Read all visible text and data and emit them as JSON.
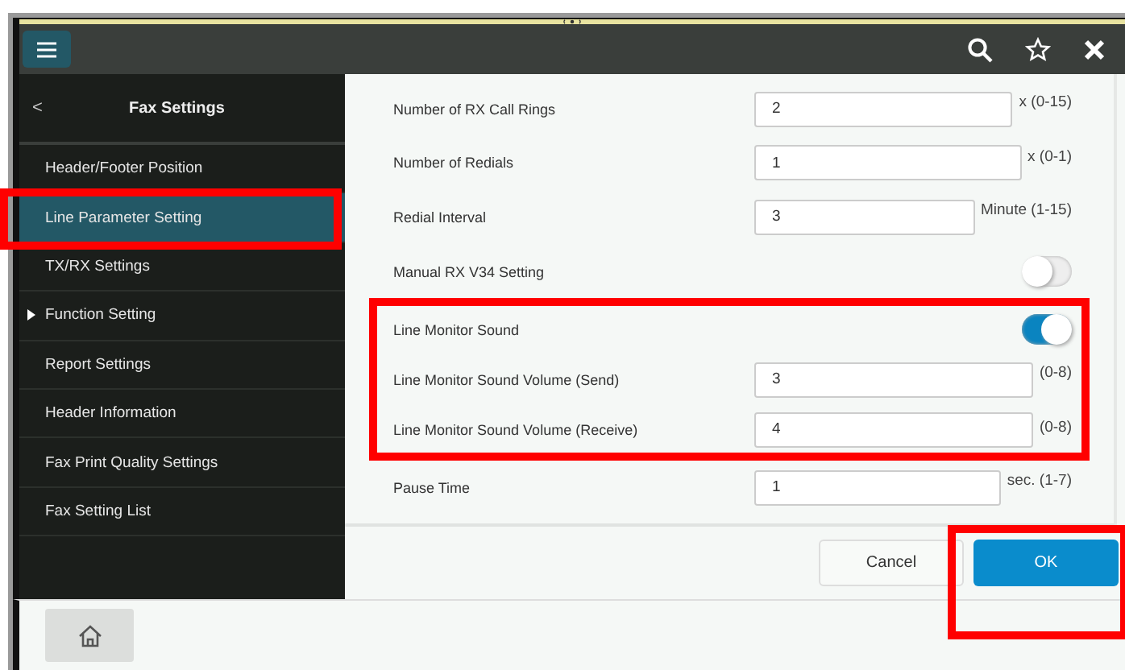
{
  "sidebar": {
    "back": "<",
    "title": "Fax Settings",
    "items": [
      {
        "label": "Header/Footer Position",
        "selected": false,
        "highlighted": false,
        "expandable": false
      },
      {
        "label": "Line Parameter Setting",
        "selected": true,
        "highlighted": true,
        "expandable": false
      },
      {
        "label": "TX/RX Settings",
        "selected": false,
        "highlighted": false,
        "expandable": false
      },
      {
        "label": "Function Setting",
        "selected": false,
        "highlighted": false,
        "expandable": true
      },
      {
        "label": "Report Settings",
        "selected": false,
        "highlighted": false,
        "expandable": false
      },
      {
        "label": "Header Information",
        "selected": false,
        "highlighted": false,
        "expandable": false
      },
      {
        "label": "Fax Print Quality Settings",
        "selected": false,
        "highlighted": false,
        "expandable": false
      },
      {
        "label": "Fax Setting List",
        "selected": false,
        "highlighted": false,
        "expandable": false
      }
    ]
  },
  "rows": [
    {
      "kind": "number",
      "label": "Number of RX Call Rings",
      "value": "2",
      "unit": "x (0-15)",
      "highlighted": false
    },
    {
      "kind": "number",
      "label": "Number of Redials",
      "value": "1",
      "unit": "x (0-1)",
      "highlighted": false
    },
    {
      "kind": "number",
      "label": "Redial Interval",
      "value": "3",
      "unit": "Minute (1-15)",
      "highlighted": false
    },
    {
      "kind": "toggle",
      "label": "Manual RX V34 Setting",
      "on": false,
      "highlighted": false
    },
    {
      "kind": "toggle",
      "label": "Line Monitor Sound",
      "on": true,
      "highlighted": true
    },
    {
      "kind": "number",
      "label": "Line Monitor Sound Volume (Send)",
      "value": "3",
      "unit": "(0-8)",
      "highlighted": true
    },
    {
      "kind": "number",
      "label": "Line Monitor Sound Volume (Receive)",
      "value": "4",
      "unit": "(0-8)",
      "highlighted": true
    },
    {
      "kind": "number",
      "label": "Pause Time",
      "value": "1",
      "unit": "sec. (1-7)",
      "highlighted": false
    }
  ],
  "buttons": [
    {
      "label": "Cancel",
      "kind": "secondary",
      "highlighted": false
    },
    {
      "label": "OK",
      "kind": "primary",
      "highlighted": true
    }
  ]
}
